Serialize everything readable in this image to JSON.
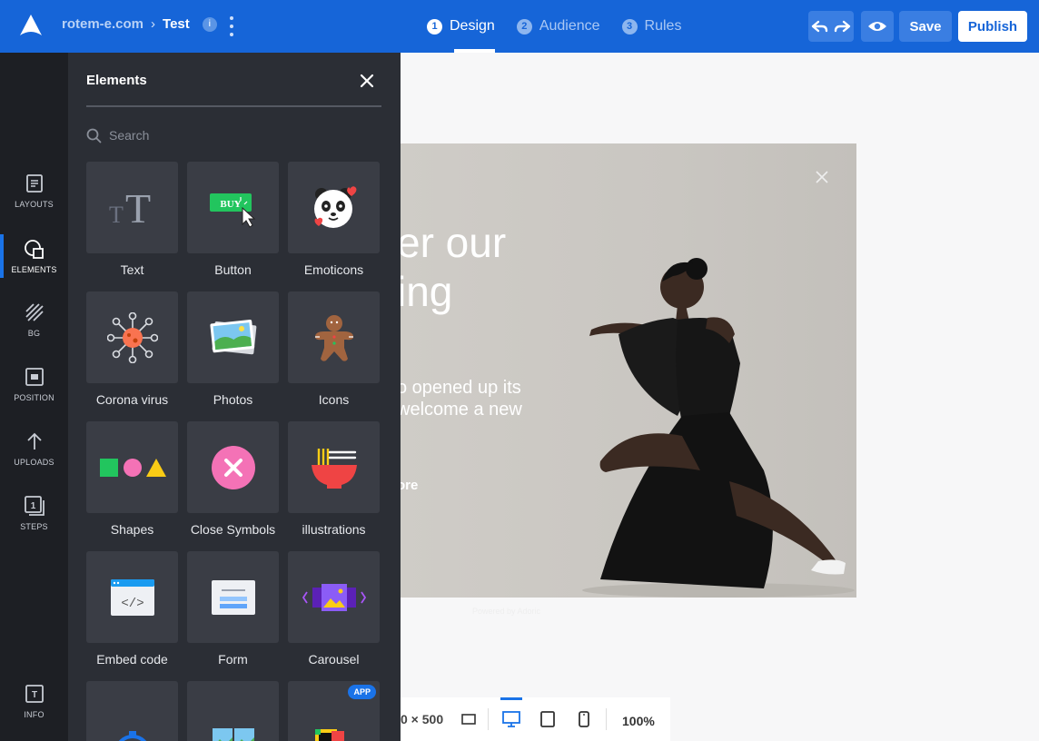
{
  "topbar": {
    "site": "rotem-e.com",
    "page": "Test",
    "info_badge": "i",
    "steps": [
      {
        "num": "1",
        "label": "Design",
        "active": true
      },
      {
        "num": "2",
        "label": "Audience",
        "active": false
      },
      {
        "num": "3",
        "label": "Rules",
        "active": false
      }
    ],
    "save_label": "Save",
    "publish_label": "Publish"
  },
  "rail": {
    "items": [
      {
        "label": "LAYOUTS",
        "icon": "layouts-icon"
      },
      {
        "label": "ELEMENTS",
        "icon": "elements-icon",
        "active": true
      },
      {
        "label": "BG",
        "icon": "bg-icon"
      },
      {
        "label": "POSITION",
        "icon": "position-icon"
      },
      {
        "label": "UPLOADS",
        "icon": "upload-icon"
      },
      {
        "label": "STEPS",
        "icon": "steps-icon"
      },
      {
        "label": "INFO",
        "icon": "info-icon"
      }
    ],
    "steps_badge": "1",
    "info_badge": "T"
  },
  "panel": {
    "title": "Elements",
    "search_placeholder": "Search",
    "tiles": [
      {
        "label": "Text",
        "icon": "text-element-icon"
      },
      {
        "label": "Button",
        "icon": "buy-button-icon",
        "icon_text": "BUY"
      },
      {
        "label": "Emoticons",
        "icon": "panda-emoticon-icon"
      },
      {
        "label": "Corona virus",
        "icon": "virus-icon"
      },
      {
        "label": "Photos",
        "icon": "photo-icon"
      },
      {
        "label": "Icons",
        "icon": "gingerbread-icon"
      },
      {
        "label": "Shapes",
        "icon": "shapes-icon"
      },
      {
        "label": "Close Symbols",
        "icon": "close-symbol-icon"
      },
      {
        "label": "illustrations",
        "icon": "noodle-bowl-icon"
      },
      {
        "label": "Embed code",
        "icon": "embed-code-icon",
        "icon_text": "</>"
      },
      {
        "label": "Form",
        "icon": "form-icon"
      },
      {
        "label": "Carousel",
        "icon": "carousel-icon"
      },
      {
        "label": "",
        "icon": "timer-icon"
      },
      {
        "label": "",
        "icon": "gallery-icon"
      },
      {
        "label": "",
        "icon": "app-icon",
        "badge": "APP"
      }
    ]
  },
  "preview": {
    "heading_line1": "er our",
    "heading_line2": "ing",
    "body_line1": "o opened up its",
    "body_line2": " welcome a new",
    "cta": "ore",
    "powered": "Powered by Adoric"
  },
  "bottom": {
    "dimensions": "0 × 500",
    "zoom": "100%"
  },
  "colors": {
    "brand": "#1665d8",
    "rail_bg": "#1d1f24",
    "panel_bg": "#2b2e35",
    "tile_bg": "#3a3d45"
  }
}
